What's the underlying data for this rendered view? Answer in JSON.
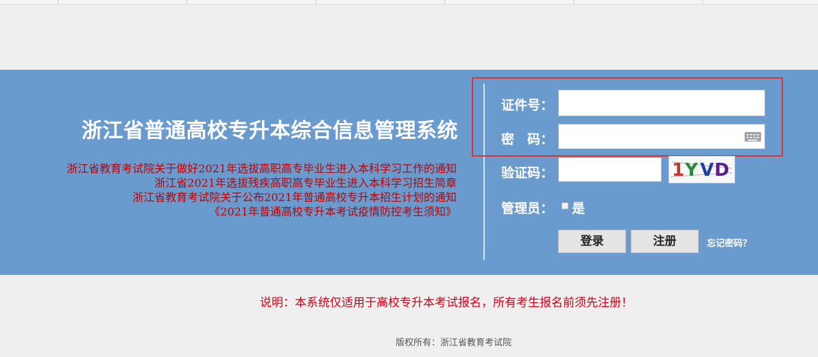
{
  "site": {
    "title": "浙江省普通高校专升本综合信息管理系统"
  },
  "notices": [
    "浙江省教育考试院关于做好2021年选拔高职高专毕业生进入本科学习工作的通知",
    "浙江省2021年选拔残疾高职高专毕业生进入本科学习招生简章",
    "浙江省教育考试院关于公布2021年普通高校专升本招生计划的通知",
    "《2021年普通高校专升本考试疫情防控考生须知》"
  ],
  "login_form": {
    "id_label": "证件号：",
    "id_value": "",
    "password_label": "密　码：",
    "password_value": "",
    "captcha_label": "验证码：",
    "captcha_value": "",
    "captcha_image_text": [
      "1",
      "Y",
      "V",
      "D"
    ],
    "admin_label": "管理员：",
    "admin_checkbox_label": "是",
    "admin_checked": false,
    "login_button": "登录",
    "register_button": "注册",
    "forgot_password": "忘记密码？"
  },
  "footer": {
    "note": "说明：本系统仅适用于高校专升本考试报名，所有考生报名前须先注册！",
    "copyright": "版权所有：浙江省教育考试院"
  },
  "colors": {
    "banner": "#6a9bcf",
    "notice_text": "#c00000",
    "note_text": "#d0021b",
    "highlight_border": "#e03030",
    "captcha_glyphs": [
      "#c0392b",
      "#2a8a3a",
      "#1f3fa0",
      "#5a1d8a"
    ]
  },
  "icons": {
    "virtual_keyboard": "keyboard-icon"
  }
}
